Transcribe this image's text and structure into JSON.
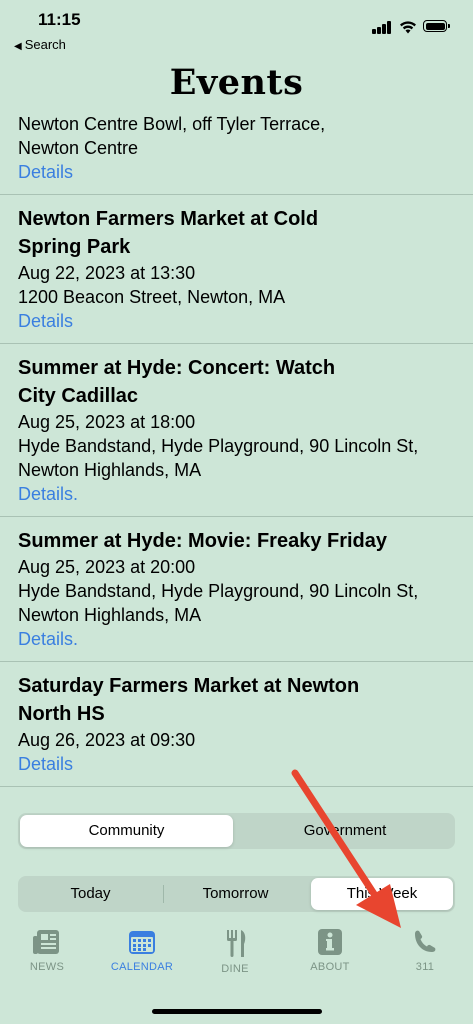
{
  "status": {
    "time": "11:15",
    "back_label": "Search"
  },
  "header": {
    "title": "Events"
  },
  "events": [
    {
      "title_partial": "Newton Centre Bowl, off Tyler Terrace,",
      "line2": "Newton Centre",
      "link": "Details"
    },
    {
      "title1": "Newton Farmers Market at Cold",
      "title2": "Spring Park",
      "date": "Aug 22, 2023 at 13:30",
      "loc1": "1200 Beacon Street, Newton, MA",
      "link": "Details"
    },
    {
      "title1": "Summer at Hyde: Concert: Watch",
      "title2": "City Cadillac",
      "date": "Aug 25, 2023 at 18:00",
      "loc1": "Hyde Bandstand, Hyde Playground, 90 Lincoln St,",
      "loc2": "Newton Highlands, MA",
      "link": "Details."
    },
    {
      "title1": "Summer at Hyde: Movie: Freaky Friday",
      "date": "Aug 25, 2023 at 20:00",
      "loc1": "Hyde Bandstand, Hyde Playground, 90 Lincoln St,",
      "loc2": "Newton Highlands, MA",
      "link": "Details."
    },
    {
      "title1": "Saturday Farmers Market at Newton",
      "title2": "North HS",
      "date": "Aug 26, 2023 at 09:30",
      "link": "Details"
    }
  ],
  "category_segment": {
    "options": [
      "Community",
      "Government"
    ],
    "selected": "Community"
  },
  "time_segment": {
    "options": [
      "Today",
      "Tomorrow",
      "This Week"
    ],
    "selected": "This Week"
  },
  "tabbar": {
    "tabs": [
      {
        "label": "NEWS",
        "icon": "newspaper-icon"
      },
      {
        "label": "CALENDAR",
        "icon": "calendar-icon",
        "active": true
      },
      {
        "label": "DINE",
        "icon": "fork-knife-icon"
      },
      {
        "label": "ABOUT",
        "icon": "info-icon"
      },
      {
        "label": "311",
        "icon": "phone-icon"
      }
    ]
  },
  "colors": {
    "background": "#cde6d7",
    "link": "#3a7fe0",
    "annotation_arrow": "#e8452f"
  }
}
